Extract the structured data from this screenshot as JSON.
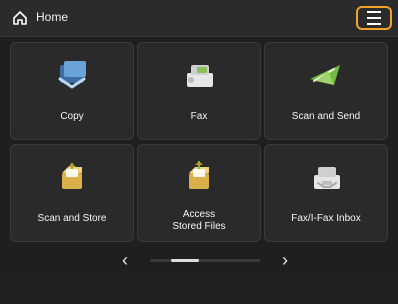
{
  "header": {
    "title": "Home",
    "home_icon": "home-icon",
    "menu_icon": "menu-icon",
    "menu_highlight_color": "#f0a22a"
  },
  "tiles": [
    {
      "label": "Copy",
      "icon": "copy-icon"
    },
    {
      "label": "Fax",
      "icon": "fax-icon"
    },
    {
      "label": "Scan and Send",
      "icon": "scan-send-icon"
    },
    {
      "label": "Scan and Store",
      "icon": "scan-store-icon"
    },
    {
      "label_line1": "Access",
      "label_line2": "Stored Files",
      "icon": "stored-files-icon"
    },
    {
      "label": "Fax/I-Fax Inbox",
      "icon": "inbox-icon"
    }
  ],
  "pager": {
    "left_arrow": "‹",
    "right_arrow": "›",
    "position": 0.25
  }
}
